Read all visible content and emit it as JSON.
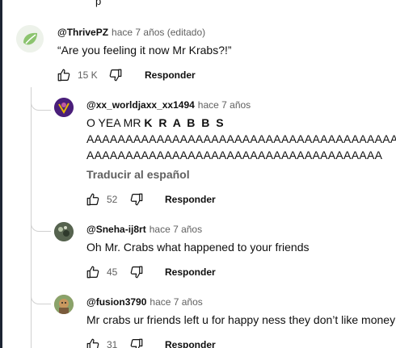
{
  "top_fragment": "p",
  "comments": [
    {
      "handle": "@ThrivePZ",
      "time": "hace 7 años (editado)",
      "text": "“Are you feeling it now Mr Krabs?!”",
      "likes": "15 K",
      "reply_label": "Responder",
      "avatar_color": "#e8efe4"
    },
    {
      "handle": "@xx_worldjaxx_xx1494",
      "time": "hace 7 años",
      "text_prefix": "O YEA MR ",
      "text_bold": "K R A B B S",
      "line2": "AAAAAAAAAAAAAAAAAAAAAAAAAAAAAAAAAAAAAAAAAAAAAAA",
      "line3": "AAAAAAAAAAAAAAAAAAAAAAAAAAAAAAAAAAAAAA",
      "translate_label": "Traducir al español",
      "likes": "52",
      "reply_label": "Responder",
      "avatar_color": "#5a2a8a"
    },
    {
      "handle": "@Sneha-ij8rt",
      "time": "hace 7 años",
      "text": "Oh Mr. Crabs what happened to your friends",
      "likes": "45",
      "reply_label": "Responder",
      "avatar_color": "#4a5a44"
    },
    {
      "handle": "@fusion3790",
      "time": "hace 7 años",
      "text": "Mr crabs ur friends left u for happy ness they don’t like money",
      "likes": "31",
      "reply_label": "Responder",
      "avatar_color": "#9a7a55"
    }
  ]
}
